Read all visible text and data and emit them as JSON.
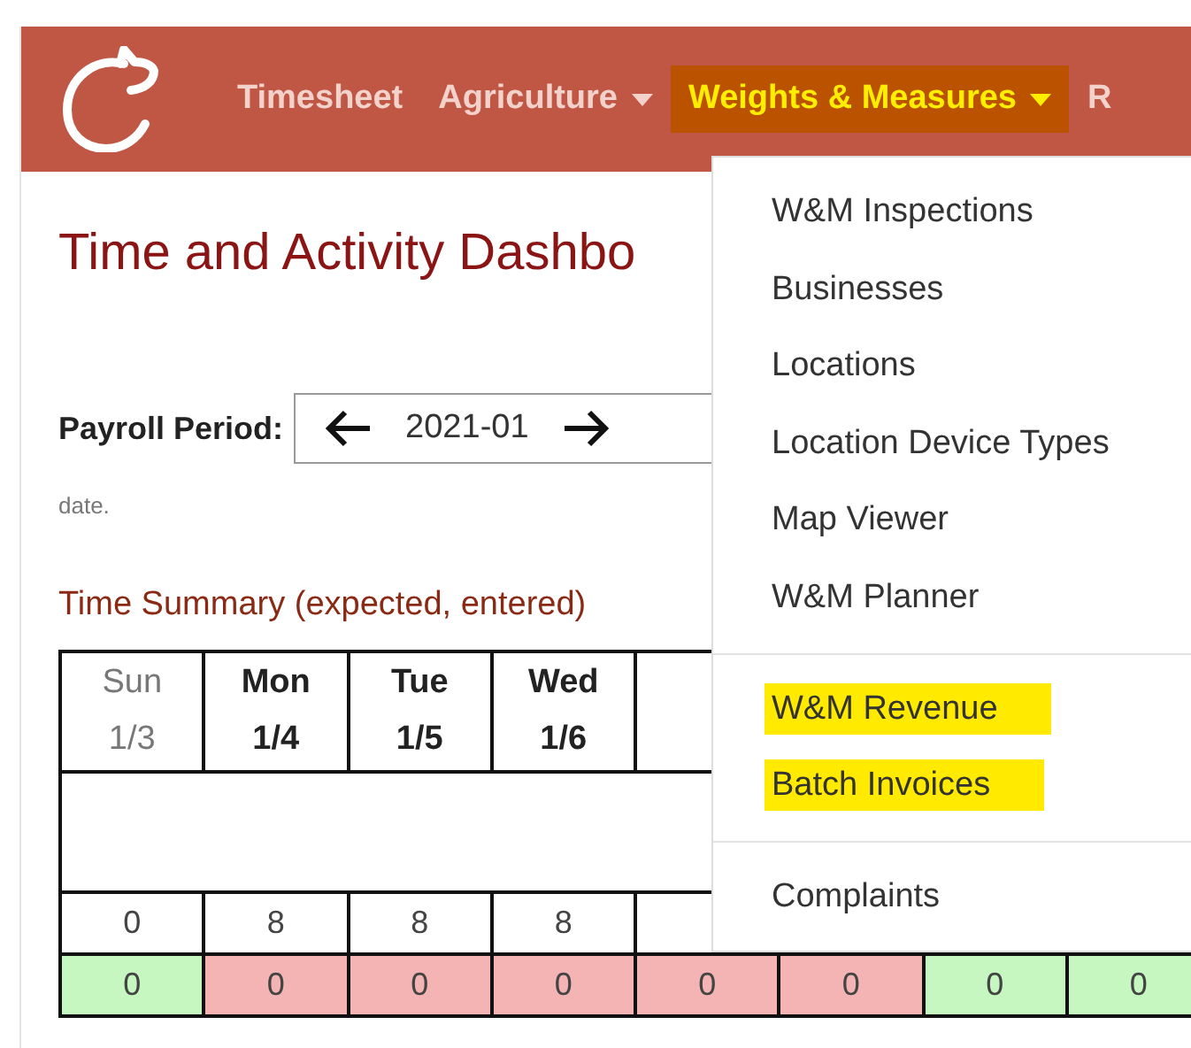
{
  "navbar": {
    "items": [
      {
        "label": "Timesheet",
        "dropdown": false,
        "selected": false
      },
      {
        "label": "Agriculture",
        "dropdown": true,
        "selected": false
      },
      {
        "label": "Weights & Measures",
        "dropdown": true,
        "selected": true
      },
      {
        "label": "R",
        "dropdown": false,
        "selected": false
      }
    ]
  },
  "page_title": "Time and Activity Dashbo",
  "payroll_period": {
    "label": "Payroll Period:",
    "value": "2021-01"
  },
  "note": "date.",
  "section_title": "Time Summary (expected, entered)",
  "summary_table": {
    "days": [
      {
        "day": "Sun",
        "date": "1/3",
        "weekend": true
      },
      {
        "day": "Mon",
        "date": "1/4",
        "weekend": false
      },
      {
        "day": "Tue",
        "date": "1/5",
        "weekend": false
      },
      {
        "day": "Wed",
        "date": "1/6",
        "weekend": false
      }
    ],
    "expected": [
      "0",
      "8",
      "8",
      "8"
    ],
    "entered": [
      {
        "value": "0",
        "color": "#c6f7c0"
      },
      {
        "value": "0",
        "color": "#f4b4b4"
      },
      {
        "value": "0",
        "color": "#f4b4b4"
      },
      {
        "value": "0",
        "color": "#f4b4b4"
      },
      {
        "value": "0",
        "color": "#f4b4b4"
      },
      {
        "value": "0",
        "color": "#f4b4b4"
      },
      {
        "value": "0",
        "color": "#c6f7c0"
      },
      {
        "value": "0",
        "color": "#c6f7c0"
      }
    ]
  },
  "dropdown_menu": {
    "items": [
      {
        "kind": "item",
        "label": "W&M Inspections",
        "highlighted": false
      },
      {
        "kind": "item",
        "label": "Businesses",
        "highlighted": false
      },
      {
        "kind": "item",
        "label": "Locations",
        "highlighted": false
      },
      {
        "kind": "item",
        "label": "Location Device Types",
        "highlighted": false
      },
      {
        "kind": "item",
        "label": "Map Viewer",
        "highlighted": false
      },
      {
        "kind": "item",
        "label": "W&M Planner",
        "highlighted": false
      },
      {
        "kind": "divider"
      },
      {
        "kind": "item",
        "label": "W&M Revenue",
        "highlighted": true
      },
      {
        "kind": "item",
        "label": "Batch Invoices",
        "highlighted": true
      },
      {
        "kind": "divider"
      },
      {
        "kind": "item",
        "label": "Complaints",
        "highlighted": false
      }
    ]
  }
}
